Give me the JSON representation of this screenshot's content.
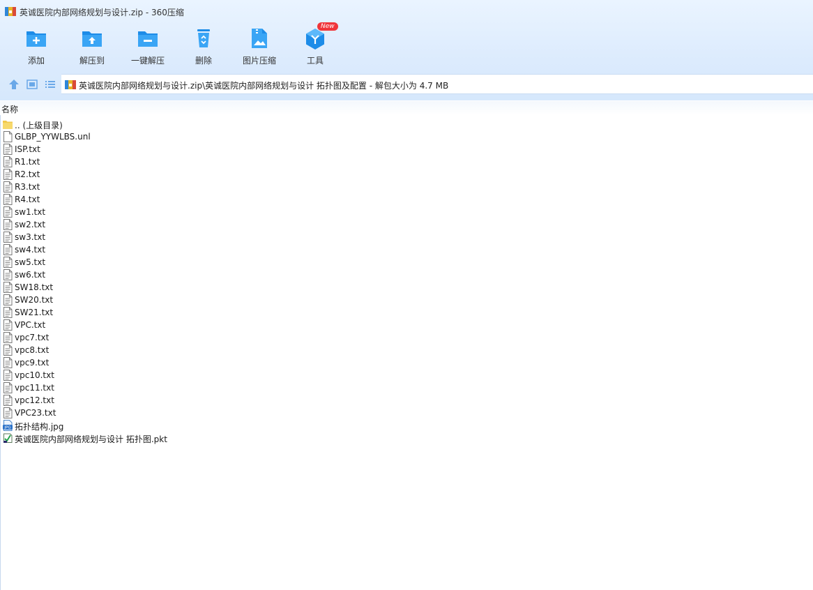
{
  "window": {
    "title": "英诚医院内部网络规划与设计.zip - 360压缩"
  },
  "toolbar": {
    "add": "添加",
    "extract_to": "解压到",
    "one_click_extract": "一键解压",
    "delete": "删除",
    "image_compress": "图片压缩",
    "tools": "工具",
    "tools_badge": "New"
  },
  "address": {
    "path": "英诚医院内部网络规划与设计.zip\\英诚医院内部网络规划与设计 拓扑图及配置 - 解包大小为 4.7 MB"
  },
  "list_header": {
    "name": "名称"
  },
  "files": [
    {
      "name": ".. (上级目录)",
      "icon": "folder-icon"
    },
    {
      "name": "GLBP_YYWLBS.unl",
      "icon": "blank-file-icon"
    },
    {
      "name": "ISP.txt",
      "icon": "text-file-icon"
    },
    {
      "name": "R1.txt",
      "icon": "text-file-icon"
    },
    {
      "name": "R2.txt",
      "icon": "text-file-icon"
    },
    {
      "name": "R3.txt",
      "icon": "text-file-icon"
    },
    {
      "name": "R4.txt",
      "icon": "text-file-icon"
    },
    {
      "name": "sw1.txt",
      "icon": "text-file-icon"
    },
    {
      "name": "sw2.txt",
      "icon": "text-file-icon"
    },
    {
      "name": "sw3.txt",
      "icon": "text-file-icon"
    },
    {
      "name": "sw4.txt",
      "icon": "text-file-icon"
    },
    {
      "name": "sw5.txt",
      "icon": "text-file-icon"
    },
    {
      "name": "sw6.txt",
      "icon": "text-file-icon"
    },
    {
      "name": "SW18.txt",
      "icon": "text-file-icon"
    },
    {
      "name": "SW20.txt",
      "icon": "text-file-icon"
    },
    {
      "name": "SW21.txt",
      "icon": "text-file-icon"
    },
    {
      "name": "VPC.txt",
      "icon": "text-file-icon"
    },
    {
      "name": "vpc7.txt",
      "icon": "text-file-icon"
    },
    {
      "name": "vpc8.txt",
      "icon": "text-file-icon"
    },
    {
      "name": "vpc9.txt",
      "icon": "text-file-icon"
    },
    {
      "name": "vpc10.txt",
      "icon": "text-file-icon"
    },
    {
      "name": "vpc11.txt",
      "icon": "text-file-icon"
    },
    {
      "name": "vpc12.txt",
      "icon": "text-file-icon"
    },
    {
      "name": "VPC23.txt",
      "icon": "text-file-icon"
    },
    {
      "name": "拓扑结构.jpg",
      "icon": "jpg-file-icon"
    },
    {
      "name": "英诚医院内部网络规划与设计 拓扑图.pkt",
      "icon": "packet-tracer-file-icon"
    }
  ]
}
